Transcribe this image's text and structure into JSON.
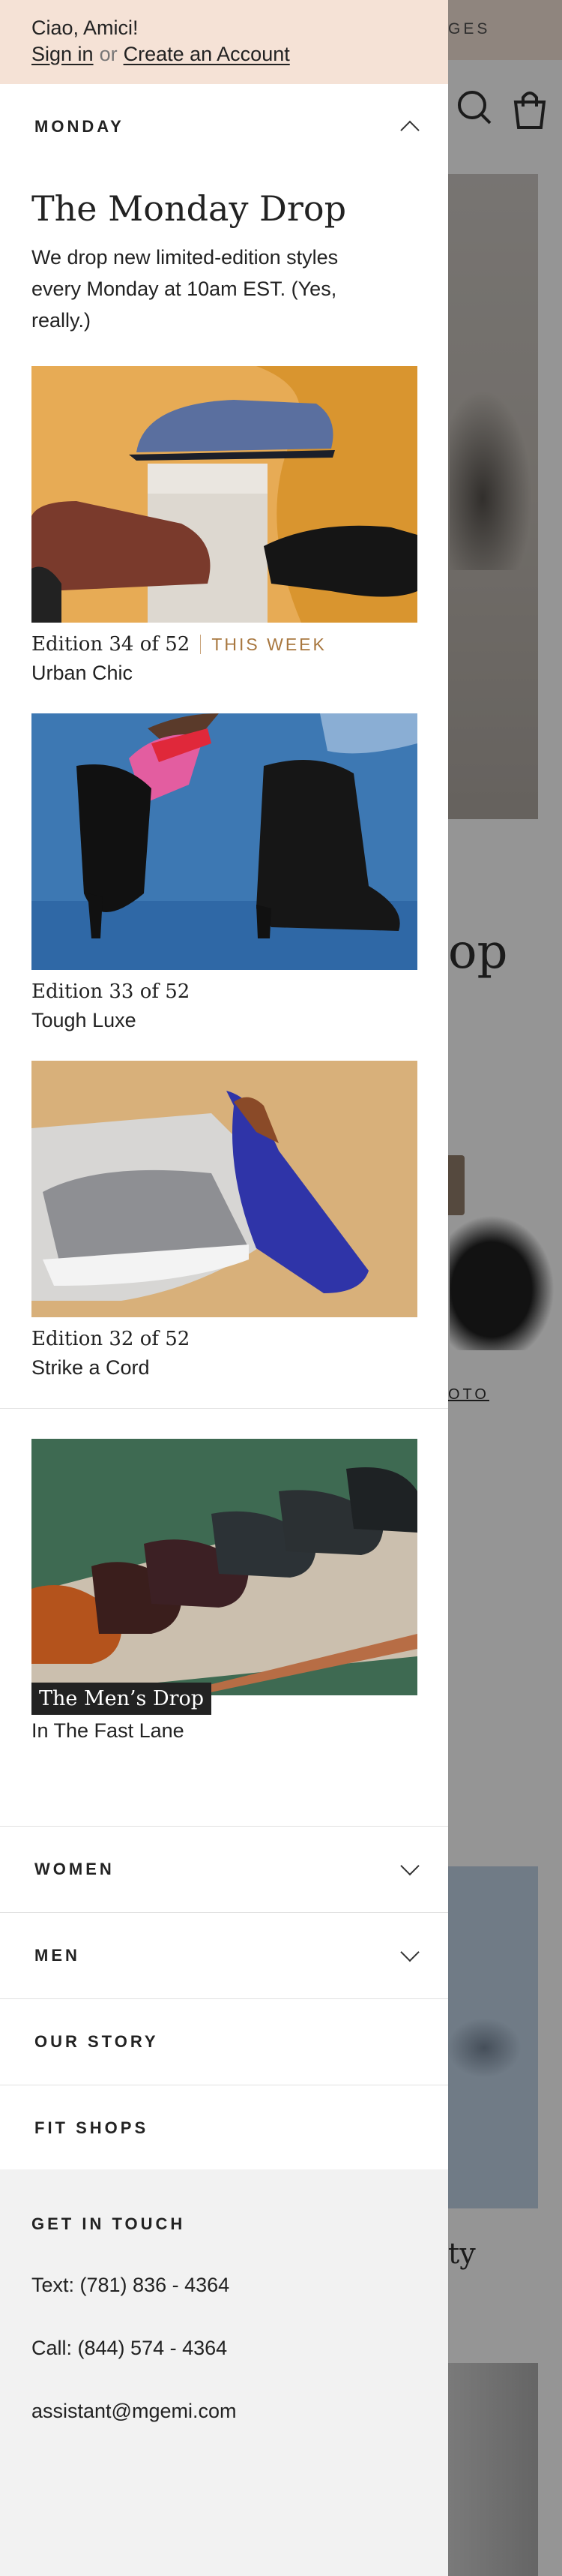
{
  "background": {
    "top_bar_text": "GES",
    "heading_fragment": "op",
    "link_fragment": "OTO",
    "tile_text_fragment": "ty"
  },
  "greeting": {
    "hello": "Ciao, Amici!",
    "sign_in": "Sign in",
    "or": "or",
    "create_account": "Create an Account"
  },
  "menu": {
    "monday_label": "MONDAY",
    "drop_title": "The Monday Drop",
    "drop_description": "We drop new limited-edition styles every Monday at 10am EST. (Yes, really.)",
    "editions": [
      {
        "edition": "Edition 34 of 52",
        "badge": "THIS WEEK",
        "name": "Urban Chic"
      },
      {
        "edition": "Edition 33 of 52",
        "name": "Tough Luxe"
      },
      {
        "edition": "Edition 32 of 52",
        "name": "Strike a Cord"
      }
    ],
    "mens_drop": {
      "badge": "The Men’s Drop",
      "name": "In The Fast Lane"
    },
    "sections": [
      "WOMEN",
      "MEN",
      "OUR STORY",
      "FIT SHOPS"
    ]
  },
  "contact": {
    "heading": "GET IN TOUCH",
    "text_line": "Text: (781) 836 - 4364",
    "call_line": "Call: (844) 574 - 4364",
    "email": "assistant@mgemi.com"
  },
  "icons": [
    "search-icon",
    "bag-icon",
    "chevron-up-icon",
    "chevron-down-icon"
  ],
  "colors": {
    "greeting_bg": "#f5e2d6",
    "accent": "#a8773f",
    "contact_bg": "#f2f2f2"
  }
}
